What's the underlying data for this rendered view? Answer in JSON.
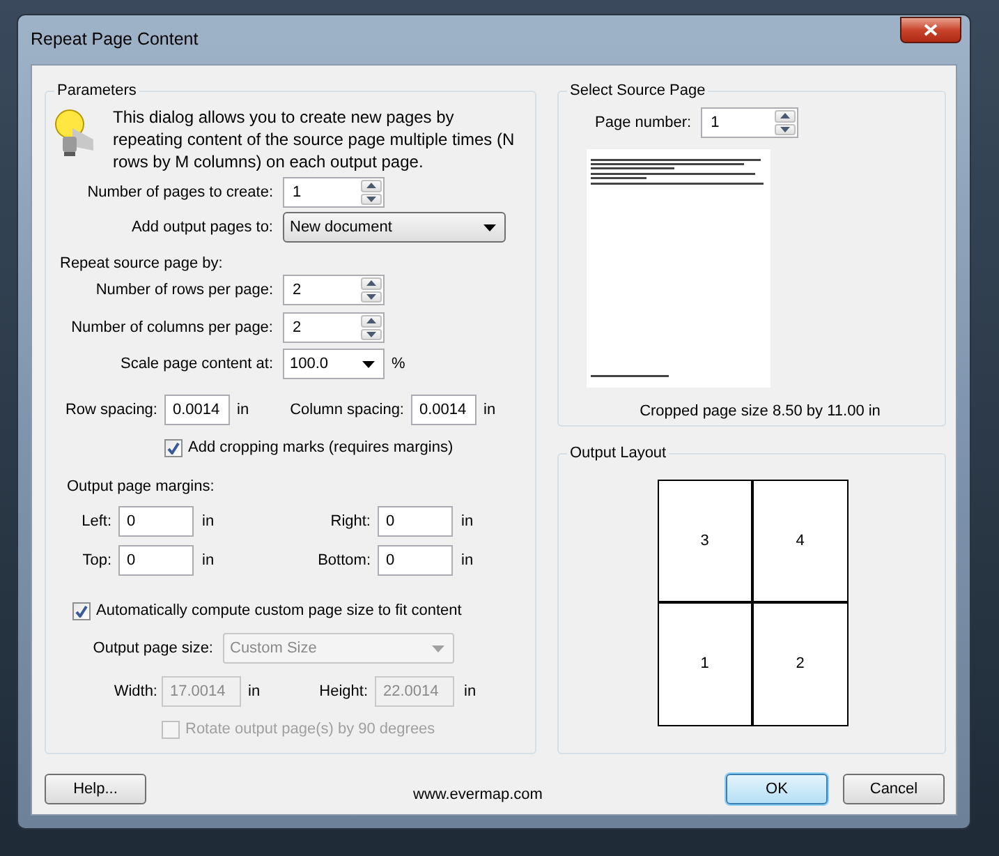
{
  "window": {
    "title": "Repeat Page Content"
  },
  "parameters": {
    "title": "Parameters",
    "description": "This dialog allows you to create new pages by repeating content of the source page multiple times (N rows by M columns) on each output page.",
    "pages_to_create": {
      "label": "Number of pages to create:",
      "value": "1"
    },
    "add_output_pages_to": {
      "label": "Add output pages to:",
      "value": "New document"
    },
    "repeat_heading": "Repeat source page by:",
    "rows_per_page": {
      "label": "Number of rows per page:",
      "value": "2"
    },
    "columns_per_page": {
      "label": "Number of columns per page:",
      "value": "2"
    },
    "scale": {
      "label": "Scale page content at:",
      "value": "100.0",
      "unit": "%"
    },
    "row_spacing": {
      "label": "Row spacing:",
      "value": "0.0014",
      "unit": "in"
    },
    "column_spacing": {
      "label": "Column spacing:",
      "value": "0.0014",
      "unit": "in"
    },
    "cropping_marks": {
      "label": "Add cropping marks (requires margins)",
      "checked": true
    },
    "margins_heading": "Output page margins:",
    "margins": [
      {
        "label": "Left:",
        "value": "0",
        "unit": "in"
      },
      {
        "label": "Right:",
        "value": "0",
        "unit": "in"
      },
      {
        "label": "Top:",
        "value": "0",
        "unit": "in"
      },
      {
        "label": "Bottom:",
        "value": "0",
        "unit": "in"
      }
    ],
    "auto_size": {
      "label": "Automatically compute custom page size to fit content",
      "checked": true
    },
    "output_page_size": {
      "label": "Output page size:",
      "value": "Custom Size",
      "disabled": true
    },
    "width": {
      "label": "Width:",
      "value": "17.0014",
      "unit": "in",
      "disabled": true
    },
    "height": {
      "label": "Height:",
      "value": "22.0014",
      "unit": "in",
      "disabled": true
    },
    "rotate": {
      "label": "Rotate output page(s) by 90 degrees",
      "checked": false,
      "disabled": true
    }
  },
  "source_page": {
    "title": "Select Source Page",
    "page_number": {
      "label": "Page number:",
      "value": "1"
    },
    "page_size": "Cropped page size 8.50 by 11.00 in"
  },
  "output_layout": {
    "title": "Output Layout",
    "cells": [
      "3",
      "4",
      "1",
      "2"
    ]
  },
  "footer": {
    "help": "Help...",
    "url": "www.evermap.com",
    "ok": "OK",
    "cancel": "Cancel"
  }
}
